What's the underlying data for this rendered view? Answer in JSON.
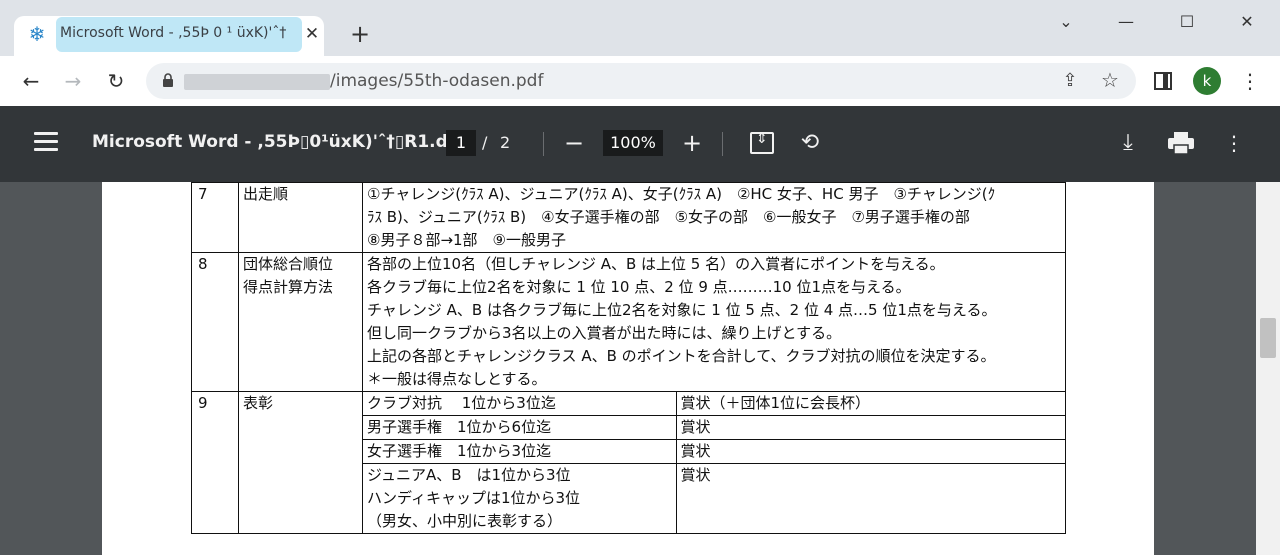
{
  "browser": {
    "tab_title": "Microsoft Word - ,55Þ 0 ¹ üxK)'ˆ†",
    "tab_close": "✕",
    "new_tab": "+",
    "url_path": "/images/55th-odasen.pdf",
    "avatar_letter": "k",
    "window_controls": {
      "dropdown": "⌄",
      "minimize": "—",
      "maximize": "☐",
      "close": "✕"
    }
  },
  "pdf_toolbar": {
    "title": "Microsoft Word - ,55Þ▯0¹üxK)'ˆ†▯R1.d...",
    "current_page": "1",
    "page_separator": "/",
    "total_pages": "2",
    "zoom": "100%"
  },
  "document": {
    "rows": [
      {
        "num": "7",
        "item": "出走順",
        "lines": [
          "①チャレンジ(ｸﾗｽ A)、ジュニア(ｸﾗｽ A)、女子(ｸﾗｽ A)　②HC 女子、HC 男子　③チャレンジ(ｸ",
          "ﾗｽ B)、ジュニア(ｸﾗｽ B)　④女子選手権の部　⑤女子の部　⑥一般女子　⑦男子選手権の部",
          "⑧男子８部→1部　⑨一般男子"
        ]
      },
      {
        "num": "8",
        "item_lines": [
          "団体総合順位",
          "得点計算方法"
        ],
        "lines": [
          "各部の上位10名（但しチャレンジ A、B は上位 5 名）の入賞者にポイントを与える。",
          "各クラブ毎に上位2名を対象に 1 位 10 点、2 位 9 点………10 位1点を与える。",
          "チャレンジ A、B は各クラブ毎に上位2名を対象に 1 位 5 点、2 位 4 点…5 位1点を与える。",
          "但し同一クラブから3名以上の入賞者が出た時には、繰り上げとする。",
          "上記の各部とチャレンジクラス A、B のポイントを合計して、クラブ対抗の順位を決定する。",
          "＊一般は得点なしとする。"
        ]
      },
      {
        "num": "9",
        "item": "表彰",
        "awards": [
          {
            "left": [
              "クラブ対抗　 1位から3位迄"
            ],
            "right": "賞状（＋団体1位に会長杯）"
          },
          {
            "left": [
              "男子選手権　1位から6位迄"
            ],
            "right": "賞状"
          },
          {
            "left": [
              "女子選手権　1位から3位迄"
            ],
            "right": "賞状"
          },
          {
            "left": [
              "ジュニアA、B　は1位から3位",
              "ハンディキャップは1位から3位",
              "（男女、小中別に表彰する）"
            ],
            "right": "賞状"
          }
        ]
      }
    ]
  }
}
